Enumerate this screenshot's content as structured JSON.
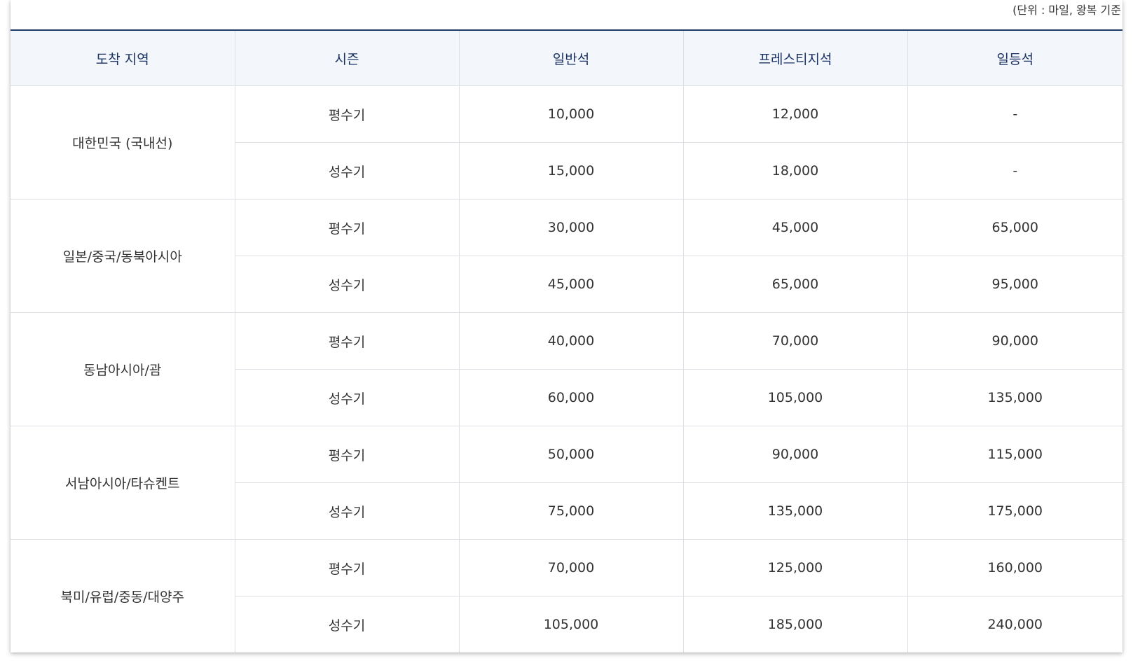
{
  "unit_note": "(단위 : 마일, 왕복 기준",
  "headers": [
    "도착 지역",
    "시즌",
    "일반석",
    "프레스티지석",
    "일등석"
  ],
  "regions": [
    {
      "name": "대한민국 (국내선)",
      "rows": [
        {
          "season": "평수기",
          "economy": "10,000",
          "prestige": "12,000",
          "first": "-"
        },
        {
          "season": "성수기",
          "economy": "15,000",
          "prestige": "18,000",
          "first": "-"
        }
      ]
    },
    {
      "name": "일본/중국/동북아시아",
      "rows": [
        {
          "season": "평수기",
          "economy": "30,000",
          "prestige": "45,000",
          "first": "65,000"
        },
        {
          "season": "성수기",
          "economy": "45,000",
          "prestige": "65,000",
          "first": "95,000"
        }
      ]
    },
    {
      "name": "동남아시아/괌",
      "rows": [
        {
          "season": "평수기",
          "economy": "40,000",
          "prestige": "70,000",
          "first": "90,000"
        },
        {
          "season": "성수기",
          "economy": "60,000",
          "prestige": "105,000",
          "first": "135,000"
        }
      ]
    },
    {
      "name": "서남아시아/타슈켄트",
      "rows": [
        {
          "season": "평수기",
          "economy": "50,000",
          "prestige": "90,000",
          "first": "115,000"
        },
        {
          "season": "성수기",
          "economy": "75,000",
          "prestige": "135,000",
          "first": "175,000"
        }
      ]
    },
    {
      "name": "북미/유럽/중동/대양주",
      "rows": [
        {
          "season": "평수기",
          "economy": "70,000",
          "prestige": "125,000",
          "first": "160,000"
        },
        {
          "season": "성수기",
          "economy": "105,000",
          "prestige": "185,000",
          "first": "240,000"
        }
      ]
    }
  ],
  "colors": {
    "header_text": "#1a3263",
    "header_bg": "#f3f6fb",
    "top_rule": "#1f3a66",
    "border": "#dcdfe4",
    "body_text": "#333333"
  }
}
